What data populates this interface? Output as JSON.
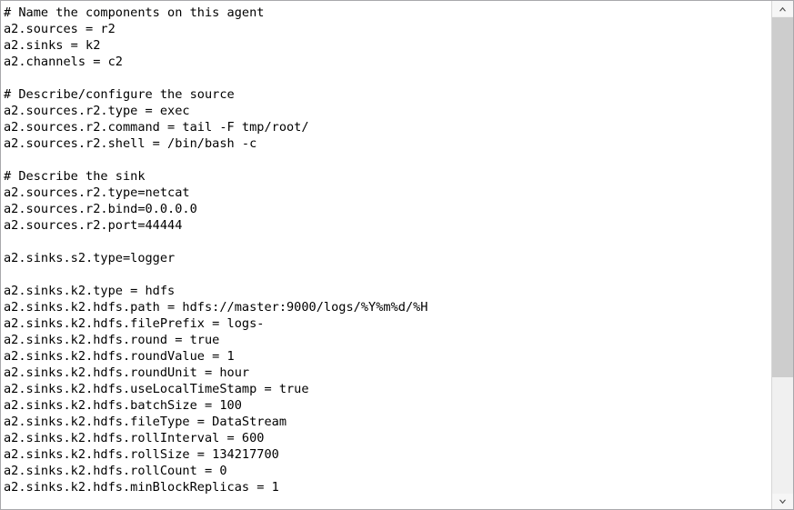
{
  "editor": {
    "content_type": "flume-agent-config",
    "lines": [
      "# Name the components on this agent",
      "a2.sources = r2",
      "a2.sinks = k2",
      "a2.channels = c2",
      "",
      "# Describe/configure the source",
      "a2.sources.r2.type = exec",
      "a2.sources.r2.command = tail -F tmp/root/",
      "a2.sources.r2.shell = /bin/bash -c",
      "",
      "# Describe the sink",
      "a2.sources.r2.type=netcat",
      "a2.sources.r2.bind=0.0.0.0",
      "a2.sources.r2.port=44444",
      "",
      "a2.sinks.s2.type=logger",
      "",
      "a2.sinks.k2.type = hdfs",
      "a2.sinks.k2.hdfs.path = hdfs://master:9000/logs/%Y%m%d/%H",
      "a2.sinks.k2.hdfs.filePrefix = logs-",
      "a2.sinks.k2.hdfs.round = true",
      "a2.sinks.k2.hdfs.roundValue = 1",
      "a2.sinks.k2.hdfs.roundUnit = hour",
      "a2.sinks.k2.hdfs.useLocalTimeStamp = true",
      "a2.sinks.k2.hdfs.batchSize = 100",
      "a2.sinks.k2.hdfs.fileType = DataStream",
      "a2.sinks.k2.hdfs.rollInterval = 600",
      "a2.sinks.k2.hdfs.rollSize = 134217700",
      "a2.sinks.k2.hdfs.rollCount = 0",
      "a2.sinks.k2.hdfs.minBlockReplicas = 1"
    ],
    "text_color": "#000000",
    "background_color": "#ffffff"
  },
  "scrollbar": {
    "up_arrow_icon": "chevron-up-icon",
    "down_arrow_icon": "chevron-down-icon",
    "thumb_color": "#cdcdcd",
    "track_color": "#f0f0f0",
    "orientation": "vertical"
  }
}
